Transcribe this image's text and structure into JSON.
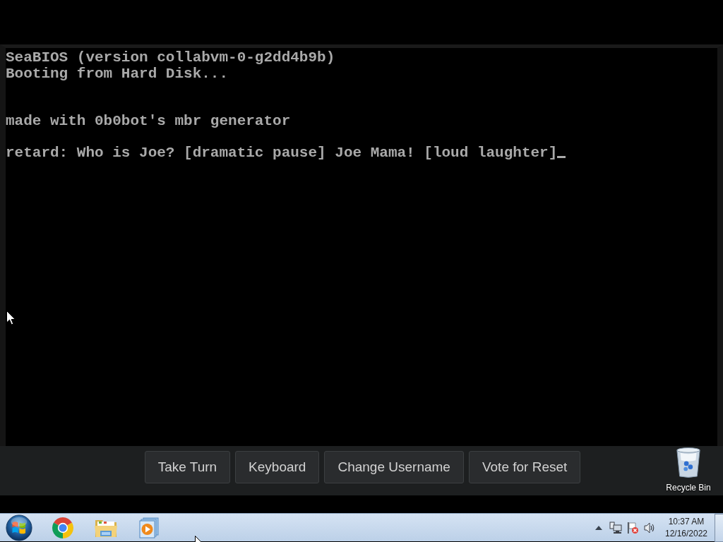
{
  "vm_screen": {
    "lines": [
      {
        "kind": "text",
        "text": "SeaBIOS (version collabvm-0-g2dd4b9b)",
        "cursor": false
      },
      {
        "kind": "text",
        "text": "Booting from Hard Disk...",
        "cursor": false
      },
      {
        "kind": "blank"
      },
      {
        "kind": "blank"
      },
      {
        "kind": "text",
        "text": "made with 0b0bot's mbr generator",
        "cursor": false
      },
      {
        "kind": "blank"
      },
      {
        "kind": "text",
        "text": "retard: Who is Joe? [dramatic pause] Joe Mama! [loud laughter]",
        "cursor": true
      }
    ]
  },
  "vm_controls": {
    "buttons": [
      "Take Turn",
      "Keyboard",
      "Change Username",
      "Vote for Reset"
    ]
  },
  "desktop_icons": [
    {
      "label": "Recycle Bin"
    }
  ],
  "taskbar": {
    "clock": {
      "time": "10:37 AM",
      "date": "12/16/2022"
    }
  }
}
